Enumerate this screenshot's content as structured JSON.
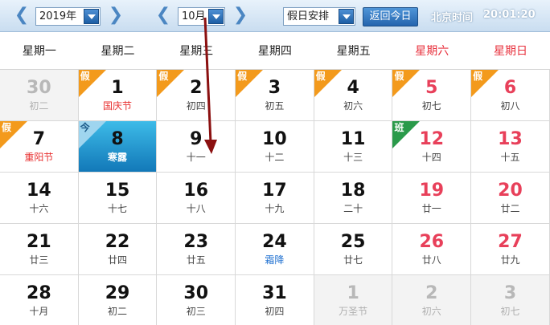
{
  "toolbar": {
    "year_value": "2019年",
    "month_value": "10月",
    "holiday_select": "假日安排",
    "today_button": "返回今日",
    "clock_label": "北京时间",
    "clock_time": "20:01:20",
    "prev_icon": "chevron-left-icon",
    "next_icon": "chevron-right-icon"
  },
  "weekdays": [
    "星期一",
    "星期二",
    "星期三",
    "星期四",
    "星期五",
    "星期六",
    "星期日"
  ],
  "colors": {
    "toolbar_bg": "#c9ddf0",
    "holiday_badge": "#f39a1c",
    "work_badge": "#2a9a4a",
    "weekend_red": "#e8405a",
    "festival_red": "#e83030",
    "solar_term_blue": "#1d6fd0",
    "today_blue": "#1f8fcf",
    "annotation_arrow": "#8b1010"
  },
  "days": [
    {
      "day": "30",
      "sub": "初二",
      "out": true,
      "weekend": false,
      "badge": null
    },
    {
      "day": "1",
      "sub": "国庆节",
      "out": false,
      "weekend": false,
      "badge": "假",
      "subType": "festival"
    },
    {
      "day": "2",
      "sub": "初四",
      "out": false,
      "weekend": false,
      "badge": "假"
    },
    {
      "day": "3",
      "sub": "初五",
      "out": false,
      "weekend": false,
      "badge": "假"
    },
    {
      "day": "4",
      "sub": "初六",
      "out": false,
      "weekend": false,
      "badge": "假"
    },
    {
      "day": "5",
      "sub": "初七",
      "out": false,
      "weekend": true,
      "badge": "假"
    },
    {
      "day": "6",
      "sub": "初八",
      "out": false,
      "weekend": true,
      "badge": "假"
    },
    {
      "day": "7",
      "sub": "重阳节",
      "out": false,
      "weekend": false,
      "badge": "假",
      "subType": "festival"
    },
    {
      "day": "8",
      "sub": "寒露",
      "out": false,
      "weekend": false,
      "badge": "今",
      "today": true
    },
    {
      "day": "9",
      "sub": "十一",
      "out": false,
      "weekend": false,
      "badge": null
    },
    {
      "day": "10",
      "sub": "十二",
      "out": false,
      "weekend": false,
      "badge": null
    },
    {
      "day": "11",
      "sub": "十三",
      "out": false,
      "weekend": false,
      "badge": null
    },
    {
      "day": "12",
      "sub": "十四",
      "out": false,
      "weekend": true,
      "badge": "班",
      "work": true
    },
    {
      "day": "13",
      "sub": "十五",
      "out": false,
      "weekend": true,
      "badge": null
    },
    {
      "day": "14",
      "sub": "十六",
      "out": false,
      "weekend": false,
      "badge": null
    },
    {
      "day": "15",
      "sub": "十七",
      "out": false,
      "weekend": false,
      "badge": null
    },
    {
      "day": "16",
      "sub": "十八",
      "out": false,
      "weekend": false,
      "badge": null
    },
    {
      "day": "17",
      "sub": "十九",
      "out": false,
      "weekend": false,
      "badge": null
    },
    {
      "day": "18",
      "sub": "二十",
      "out": false,
      "weekend": false,
      "badge": null
    },
    {
      "day": "19",
      "sub": "廿一",
      "out": false,
      "weekend": true,
      "badge": null
    },
    {
      "day": "20",
      "sub": "廿二",
      "out": false,
      "weekend": true,
      "badge": null
    },
    {
      "day": "21",
      "sub": "廿三",
      "out": false,
      "weekend": false,
      "badge": null
    },
    {
      "day": "22",
      "sub": "廿四",
      "out": false,
      "weekend": false,
      "badge": null
    },
    {
      "day": "23",
      "sub": "廿五",
      "out": false,
      "weekend": false,
      "badge": null
    },
    {
      "day": "24",
      "sub": "霜降",
      "out": false,
      "weekend": false,
      "badge": null,
      "subType": "term"
    },
    {
      "day": "25",
      "sub": "廿七",
      "out": false,
      "weekend": false,
      "badge": null
    },
    {
      "day": "26",
      "sub": "廿八",
      "out": false,
      "weekend": true,
      "badge": null
    },
    {
      "day": "27",
      "sub": "廿九",
      "out": false,
      "weekend": true,
      "badge": null
    },
    {
      "day": "28",
      "sub": "十月",
      "out": false,
      "weekend": false,
      "badge": null
    },
    {
      "day": "29",
      "sub": "初二",
      "out": false,
      "weekend": false,
      "badge": null
    },
    {
      "day": "30",
      "sub": "初三",
      "out": false,
      "weekend": false,
      "badge": null
    },
    {
      "day": "31",
      "sub": "初四",
      "out": false,
      "weekend": false,
      "badge": null
    },
    {
      "day": "1",
      "sub": "万圣节",
      "out": true,
      "weekend": false,
      "badge": null
    },
    {
      "day": "2",
      "sub": "初六",
      "out": true,
      "weekend": true,
      "badge": null
    },
    {
      "day": "3",
      "sub": "初七",
      "out": true,
      "weekend": true,
      "badge": null
    }
  ]
}
